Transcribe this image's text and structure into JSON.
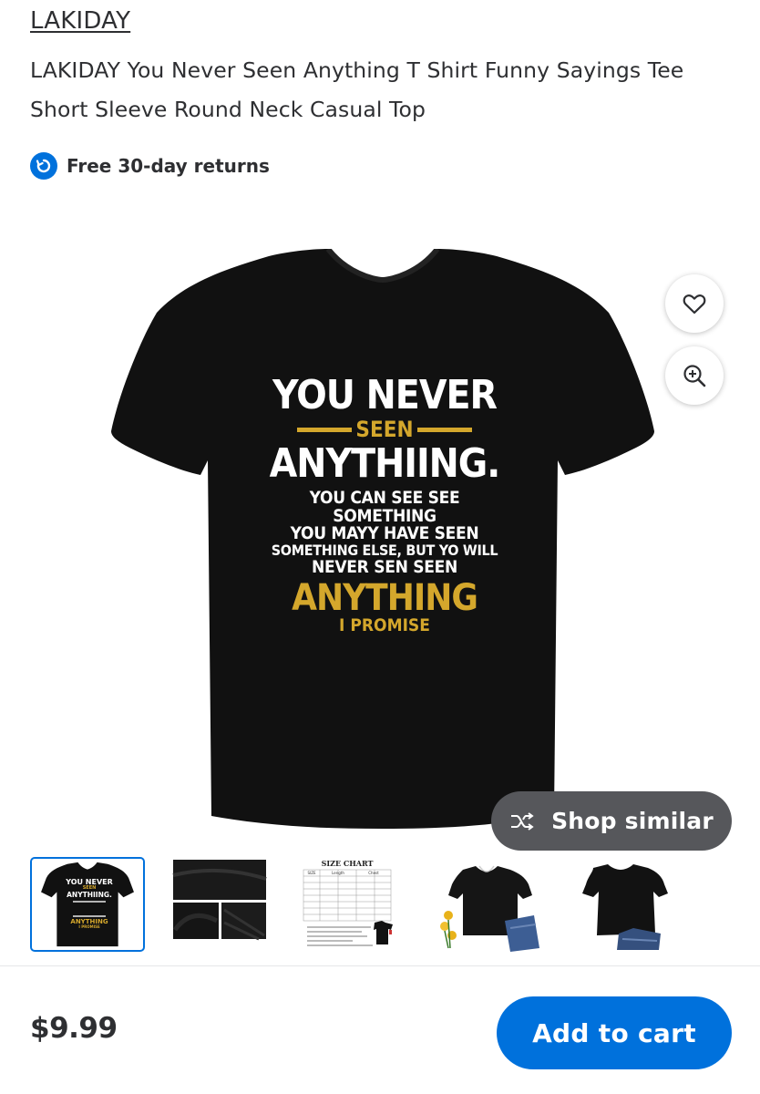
{
  "brand": "LAKIDAY",
  "product": {
    "title": "LAKIDAY You Never Seen Anything T Shirt Funny Sayings Tee Short Sleeve Round Neck Casual Top",
    "returns": "Free 30-day returns"
  },
  "shirt_print": {
    "line1": "YOU NEVER",
    "line2": "SEEN",
    "line3": "ANYTHIING.",
    "line4": "YOU CAN SEE SEE",
    "line5": "SOMETHING",
    "line6": "YOU MAYY HAVE SEEN",
    "line7": "SOMETHING ELSE, BUT YO WILL",
    "line8": "NEVER SEN SEEN",
    "line9": "ANYTHING",
    "line10": "I PROMISE"
  },
  "thumb_print": {
    "line1": "YOU NEVER",
    "line2": "SEEN",
    "line3": "ANYTHIING.",
    "line4": "ANYTHING",
    "line5": "I PROMISE"
  },
  "size_chart": {
    "title": "SIZE CHART",
    "headers": [
      "SIZE",
      "Length",
      "Chest"
    ]
  },
  "actions": {
    "shop_similar": "Shop similar",
    "add_to_cart": "Add to cart"
  },
  "price": "$9.99",
  "icons": {
    "returns": "returns-icon",
    "favorite": "heart-icon",
    "zoom": "zoom-in-icon",
    "shop_similar": "shuffle-icon"
  },
  "colors": {
    "accent": "#0071dc",
    "shop_similar_bg": "#56575b",
    "print_gold": "#d4a72c"
  }
}
